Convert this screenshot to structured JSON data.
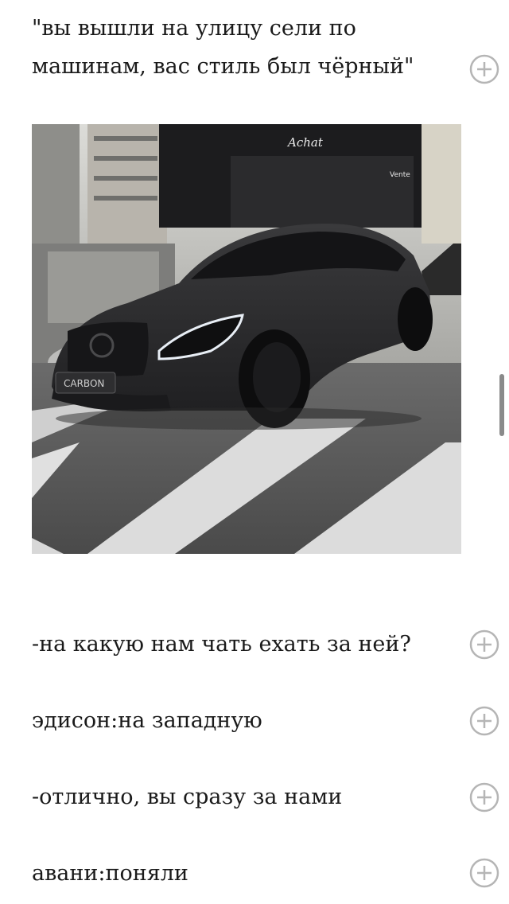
{
  "story": {
    "paragraphs": [
      {
        "text": "\"вы вышли на улицу сели по машинам, вас стиль был чёрный\""
      },
      {
        "text": "-на какую нам чать ехать за ней?"
      },
      {
        "text": "эдисон:на западную"
      },
      {
        "text": "-отлично, вы сразу за нами"
      },
      {
        "text": "авани:поняли"
      }
    ],
    "image": {
      "store_signs": [
        "Achat",
        "Vente"
      ],
      "plate_text": "CARBON"
    }
  },
  "icons": {
    "comment_add": "plus-circle-icon"
  },
  "colors": {
    "text": "#1a1a1a",
    "icon": "#b5b5b5",
    "scrollbar": "#8a8a8a"
  }
}
